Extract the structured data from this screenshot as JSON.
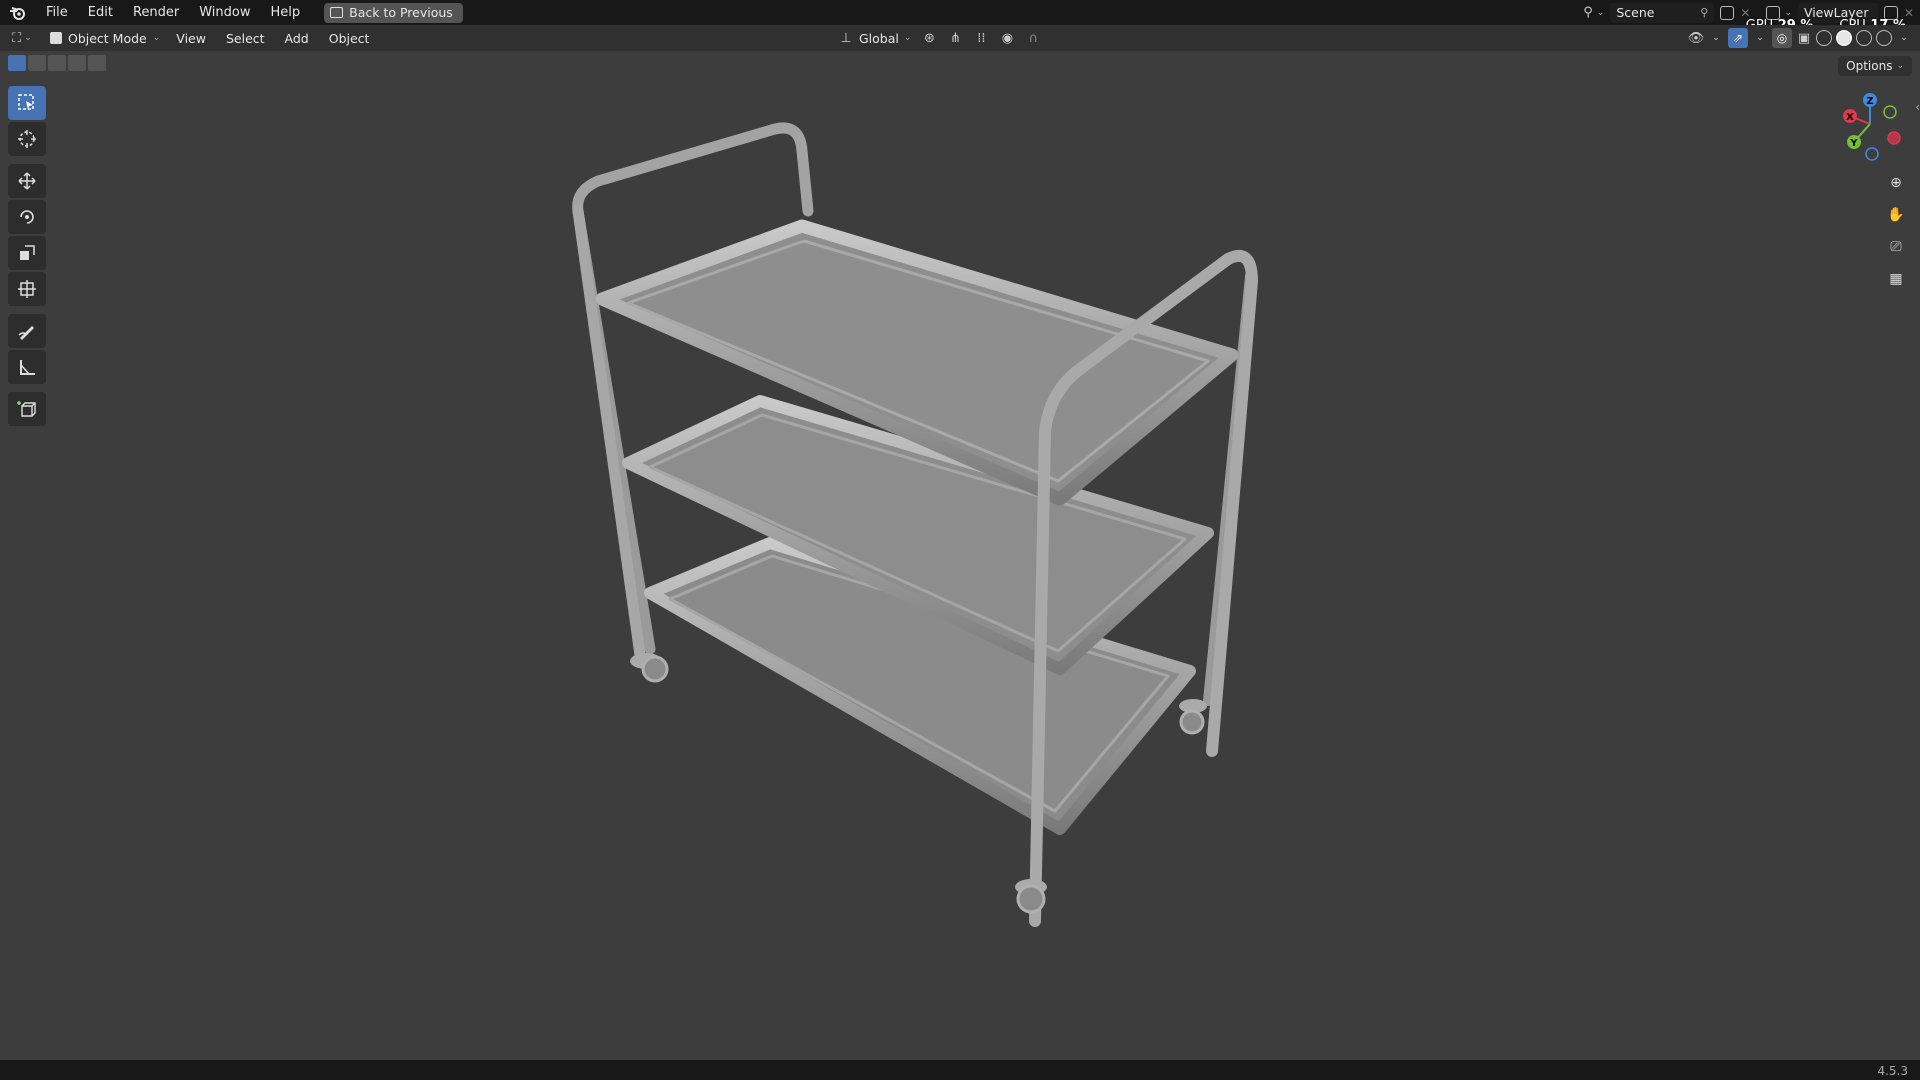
{
  "topbar": {
    "menus": [
      "File",
      "Edit",
      "Render",
      "Window",
      "Help"
    ],
    "back_label": "Back to Previous",
    "scene_name": "Scene",
    "view_layer": "ViewLayer",
    "gpu_label": "GPU",
    "gpu_value": "29 %",
    "cpu_label": "CPU",
    "cpu_value": "17 %"
  },
  "header": {
    "mode": "Object Mode",
    "menus": [
      "View",
      "Select",
      "Add",
      "Object"
    ],
    "orientation": "Global",
    "options_label": "Options"
  },
  "toolbar": {
    "tools": [
      "select-box",
      "cursor",
      "move",
      "rotate",
      "scale",
      "transform",
      "annotate",
      "measure",
      "add-cube"
    ],
    "active": "select-box"
  },
  "gizmo": {
    "axes": [
      "X",
      "Y",
      "Z"
    ],
    "colors": {
      "x": "#e0384c",
      "y": "#73c034",
      "z": "#3b8bde"
    }
  },
  "status": {
    "version": "4.5.3"
  },
  "colors": {
    "accent": "#4772b3",
    "viewport_bg": "#3d3d3d",
    "topbar_bg": "#181818"
  }
}
